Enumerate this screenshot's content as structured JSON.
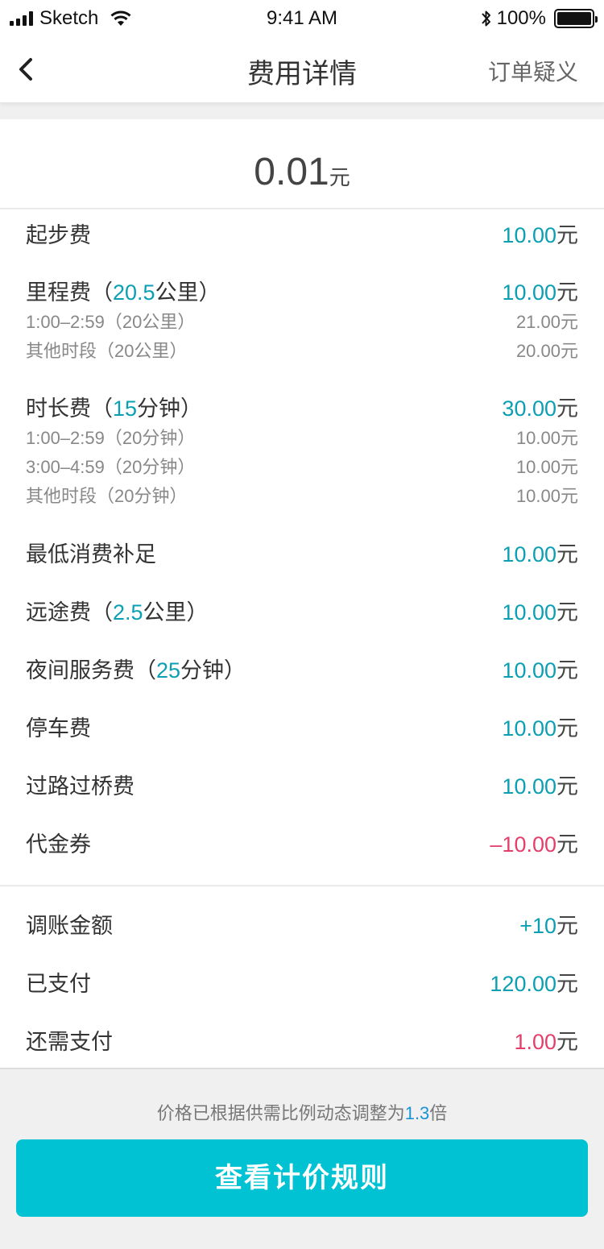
{
  "status_bar": {
    "carrier": "Sketch",
    "time": "9:41 AM",
    "battery": "100%"
  },
  "nav": {
    "title": "费用详情",
    "right_action": "订单疑义"
  },
  "total": {
    "amount": "0.01",
    "unit": "元"
  },
  "fees": {
    "base": {
      "label": "起步费",
      "amount": "10.00",
      "unit": "元"
    },
    "mileage": {
      "label": "里程费",
      "paren_open": "（",
      "paren_close": "）",
      "qty": "20.5",
      "qty_unit": "公里",
      "amount": "10.00",
      "unit": "元",
      "subs": [
        {
          "label": "1:00–2:59（20公里）",
          "value": "21.00元"
        },
        {
          "label": "其他时段（20公里）",
          "value": "20.00元"
        }
      ]
    },
    "duration": {
      "label": "时长费",
      "paren_open": "（",
      "paren_close": "）",
      "qty": "15",
      "qty_unit": "分钟",
      "amount": "30.00",
      "unit": "元",
      "subs": [
        {
          "label": "1:00–2:59（20分钟）",
          "value": "10.00元"
        },
        {
          "label": "3:00–4:59（20分钟）",
          "value": "10.00元"
        },
        {
          "label": "其他时段（20分钟）",
          "value": "10.00元"
        }
      ]
    },
    "min_charge": {
      "label": "最低消费补足",
      "amount": "10.00",
      "unit": "元"
    },
    "long_distance": {
      "label": "远途费",
      "paren_open": "（",
      "paren_close": "）",
      "qty": "2.5",
      "qty_unit": "公里",
      "amount": "10.00",
      "unit": "元"
    },
    "night": {
      "label": "夜间服务费",
      "paren_open": "（",
      "paren_close": "）",
      "qty": "25",
      "qty_unit": "分钟",
      "amount": "10.00",
      "unit": "元"
    },
    "parking": {
      "label": "停车费",
      "amount": "10.00",
      "unit": "元"
    },
    "toll": {
      "label": "过路过桥费",
      "amount": "10.00",
      "unit": "元"
    },
    "voucher": {
      "label": "代金券",
      "amount": "–10.00",
      "unit": "元"
    }
  },
  "summary": {
    "adjust": {
      "label": "调账金额",
      "amount": "+10",
      "unit": "元"
    },
    "paid": {
      "label": "已支付",
      "amount": "120.00",
      "unit": "元"
    },
    "due": {
      "label": "还需支付",
      "amount": "1.00",
      "unit": "元"
    }
  },
  "footer": {
    "note_prefix": "价格已根据供需比例动态调整为",
    "multiplier": "1.3",
    "note_suffix": "倍",
    "button": "查看计价规则"
  },
  "colors": {
    "teal": "#0b9fb3",
    "pink": "#e63e6a",
    "button": "#00c2d3",
    "multiplier_blue": "#1a94d4"
  }
}
